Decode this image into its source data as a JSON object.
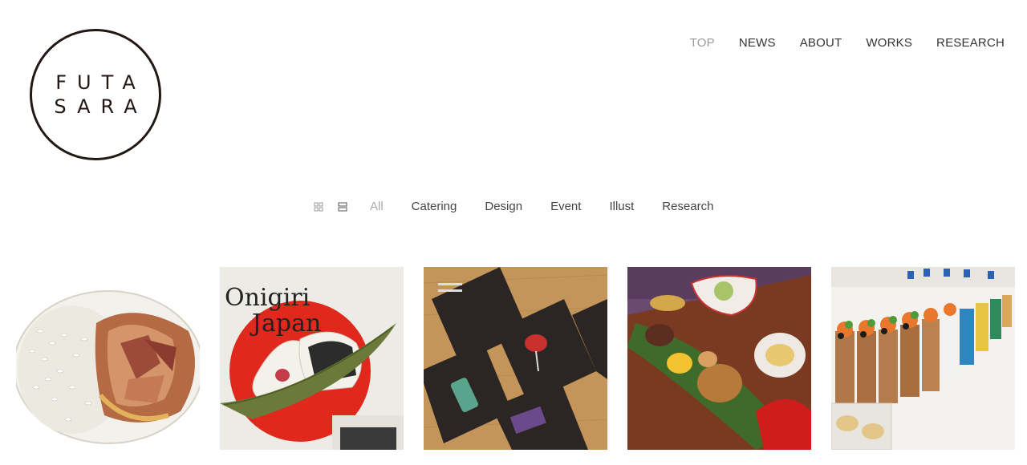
{
  "logo": {
    "line1": "FUTA",
    "line2": "SARA"
  },
  "nav": {
    "items": [
      {
        "label": "TOP",
        "active": true
      },
      {
        "label": "NEWS",
        "active": false
      },
      {
        "label": "ABOUT",
        "active": false
      },
      {
        "label": "WORKS",
        "active": false
      },
      {
        "label": "RESEARCH",
        "active": false
      }
    ]
  },
  "filters": {
    "view_icons": [
      "grid-view-icon",
      "list-view-icon"
    ],
    "items": [
      {
        "label": "All",
        "active": true
      },
      {
        "label": "Catering",
        "active": false
      },
      {
        "label": "Design",
        "active": false
      },
      {
        "label": "Event",
        "active": false
      },
      {
        "label": "Illust",
        "active": false
      },
      {
        "label": "Research",
        "active": false
      }
    ]
  },
  "works": [
    {
      "name": "curry-illustration-tile"
    },
    {
      "name": "onigiri-japan-tile",
      "title_line1": "Onigiri",
      "title_line2": "Japan"
    },
    {
      "name": "sake-cards-tile"
    },
    {
      "name": "japanese-plate-tile"
    },
    {
      "name": "catering-cups-tile"
    }
  ]
}
